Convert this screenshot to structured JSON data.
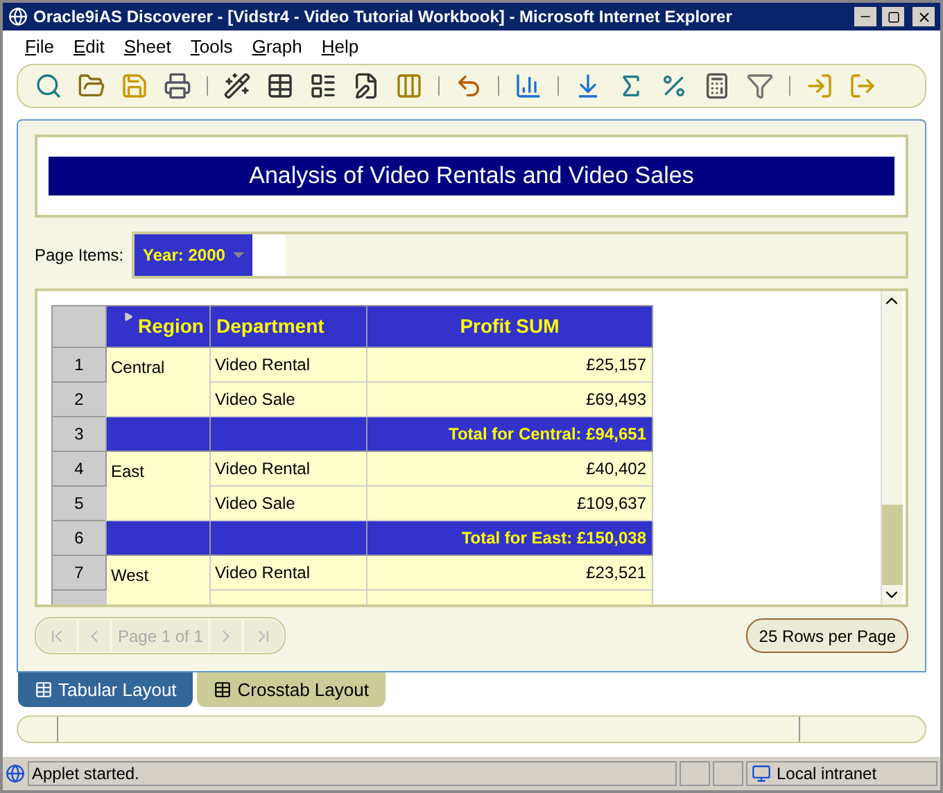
{
  "window": {
    "title": "Oracle9iAS Discoverer - [Vidstr4 - Video Tutorial Workbook] - Microsoft Internet Explorer"
  },
  "menu": [
    {
      "label": "File"
    },
    {
      "label": "Edit"
    },
    {
      "label": "Sheet"
    },
    {
      "label": "Tools"
    },
    {
      "label": "Graph"
    },
    {
      "label": "Help"
    }
  ],
  "report": {
    "title": "Analysis of Video Rentals and Video Sales"
  },
  "page_items": {
    "label": "Page Items:",
    "value": "Year: 2000"
  },
  "table": {
    "columns": [
      "Region",
      "Department",
      "Profit SUM"
    ],
    "groups": [
      {
        "region": "Central",
        "rows": [
          {
            "number": "1",
            "department": "Video Rental",
            "profit": "£25,157"
          },
          {
            "number": "2",
            "department": "Video Sale",
            "profit": "£69,493"
          }
        ],
        "total": {
          "number": "3",
          "text": "Total for Central: £94,651"
        }
      },
      {
        "region": "East",
        "rows": [
          {
            "number": "4",
            "department": "Video Rental",
            "profit": "£40,402"
          },
          {
            "number": "5",
            "department": "Video Sale",
            "profit": "£109,637"
          }
        ],
        "total": {
          "number": "6",
          "text": "Total for East: £150,038"
        }
      },
      {
        "region": "West",
        "rows": [
          {
            "number": "7",
            "department": "Video Rental",
            "profit": "£23,521"
          }
        ]
      }
    ]
  },
  "pager": {
    "page": "Page 1 of 1",
    "rows_per_page": "25 Rows per Page"
  },
  "tabs": [
    {
      "label": "Tabular Layout",
      "selected": true
    },
    {
      "label": "Crosstab Layout",
      "selected": false
    }
  ],
  "status_bar": {
    "text": "Applet started.",
    "zone": "Local intranet"
  }
}
